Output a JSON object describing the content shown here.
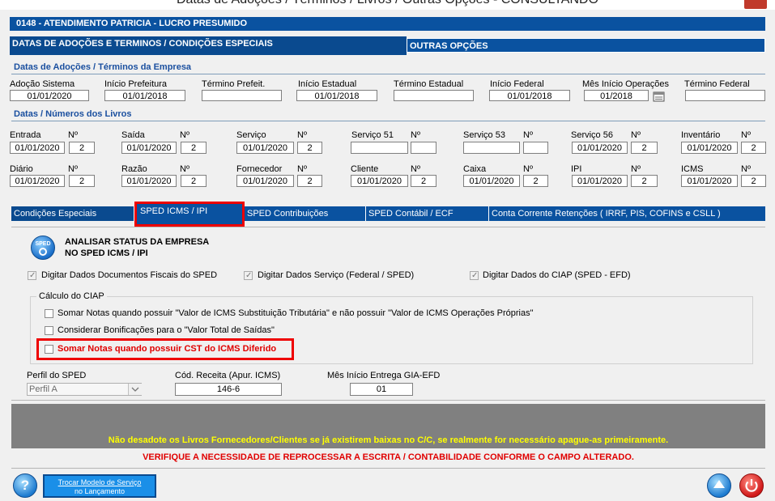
{
  "window": {
    "title": "Datas de Adoções / Términos / Livros / Outras Opções - CONSULTANDO"
  },
  "company": {
    "bar": "0148   -   ATENDIMENTO PATRICIA - LUCRO PRESUMIDO"
  },
  "top_tabs": {
    "tab1": "DATAS DE ADOÇÕES E TERMINOS / CONDIÇÕES ESPECIAIS",
    "tab2": "OUTRAS OPÇÕES"
  },
  "adocoes": {
    "section_title": "Datas de Adoções / Términos da Empresa",
    "fields": [
      {
        "label": "Adoção Sistema",
        "value": "01/01/2020"
      },
      {
        "label": "Início Prefeitura",
        "value": "01/01/2018"
      },
      {
        "label": "Término Prefeit.",
        "value": ""
      },
      {
        "label": "Início Estadual",
        "value": "01/01/2018"
      },
      {
        "label": "Término Estadual",
        "value": ""
      },
      {
        "label": "Início Federal",
        "value": "01/01/2018"
      },
      {
        "label": "Mês Início Operações",
        "value": "01/2018"
      },
      {
        "label": "Término Federal",
        "value": ""
      }
    ]
  },
  "livros": {
    "section_title": "Datas / Números dos Livros",
    "n_label": "Nº",
    "row1": [
      {
        "label": "Entrada",
        "date": "01/01/2020",
        "n": "2"
      },
      {
        "label": "Saída",
        "date": "01/01/2020",
        "n": "2"
      },
      {
        "label": "Serviço",
        "date": "01/01/2020",
        "n": "2"
      },
      {
        "label": "Serviço 51",
        "date": "",
        "n": ""
      },
      {
        "label": "Serviço 53",
        "date": "",
        "n": ""
      },
      {
        "label": "Serviço 56",
        "date": "01/01/2020",
        "n": "2"
      },
      {
        "label": "Inventário",
        "date": "01/01/2020",
        "n": "2"
      }
    ],
    "row2": [
      {
        "label": "Diário",
        "date": "01/01/2020",
        "n": "2"
      },
      {
        "label": "Razão",
        "date": "01/01/2020",
        "n": "2"
      },
      {
        "label": "Fornecedor",
        "date": "01/01/2020",
        "n": "2"
      },
      {
        "label": "Cliente",
        "date": "01/01/2020",
        "n": "2"
      },
      {
        "label": "Caixa",
        "date": "01/01/2020",
        "n": "2"
      },
      {
        "label": "IPI",
        "date": "01/01/2020",
        "n": "2"
      },
      {
        "label": "ICMS",
        "date": "01/01/2020",
        "n": "2"
      }
    ]
  },
  "content_tabs": [
    "Condições Especiais",
    "SPED ICMS / IPI",
    "SPED Contribuições",
    "SPED Contábil / ECF",
    "Conta Corrente Retenções ( IRRF,  PIS,  COFINS  e  CSLL )"
  ],
  "sped": {
    "icon_text": "SPED",
    "analisar_line1": "ANALISAR STATUS DA EMPRESA",
    "analisar_line2": "NO SPED ICMS / IPI",
    "checks": [
      {
        "label": "Digitar Dados Documentos Fiscais do SPED",
        "checked": true
      },
      {
        "label": "Digitar Dados Serviço (Federal / SPED)",
        "checked": true
      },
      {
        "label": "Digitar Dados do CIAP (SPED - EFD)",
        "checked": true
      }
    ],
    "ciap_title": "Cálculo do CIAP",
    "ciap_checks": [
      {
        "label": "Somar Notas quando possuir \"Valor de ICMS Substituição Tributária\" e não possuir \"Valor de ICMS Operações Próprias\"",
        "checked": false
      },
      {
        "label": "Considerar Bonificações para o \"Valor Total de Saídas\"",
        "checked": false
      },
      {
        "label": "Somar Notas quando possuir CST do ICMS Diferido",
        "checked": false
      }
    ],
    "perfil_label": "Perfil do SPED",
    "perfil_value": "Perfil A",
    "cod_receita_label": "Cód. Receita (Apur. ICMS)",
    "cod_receita_value": "146-6",
    "mes_gia_label": "Mês Início Entrega GIA-EFD",
    "mes_gia_value": "01"
  },
  "warnings": {
    "yellow": "Não desadote os Livros Fornecedores/Clientes se já existirem baixas no C/C, se realmente for necessário apague-as primeiramente.",
    "red": "VERIFIQUE A NECESSIDADE DE REPROCESSAR A ESCRITA / CONTABILIDADE CONFORME O CAMPO ALTERADO."
  },
  "footer": {
    "trocar_line1": "Trocar Modelo de Serviço",
    "trocar_line2": "no Lançamento",
    "help_glyph": "?"
  },
  "colors": {
    "header_blue": "#0a52a0",
    "highlight_red": "#e00000",
    "warning_yellow": "#ffff00"
  }
}
